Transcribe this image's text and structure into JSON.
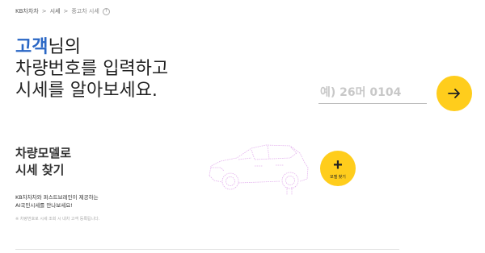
{
  "breadcrumb": {
    "home": "KB차차차",
    "section": "시세",
    "current": "중고차 시세",
    "separator": ">"
  },
  "hero": {
    "line1_accent": "고객",
    "line1_rest": "님의",
    "line2": "차량번호를 입력하고",
    "line3": "시세를 알아보세요."
  },
  "plate_search": {
    "placeholder": "예) 26머 0104",
    "value": ""
  },
  "model_search": {
    "line1": "차량모델로",
    "line2": "시세 찾기",
    "button_plus": "+",
    "button_label": "모델 찾기"
  },
  "promo": {
    "line1": "KB차차차와 퍼스트브레인이 제공하는",
    "line2": "AI국민시세를 만나보세요!"
  },
  "note": "※ 차량번호로 시세 조회 시 내차 고객 등록됩니다.",
  "colors": {
    "accent_blue": "#2a67c5",
    "button_yellow": "#ffcd1c",
    "car_outline": "#e4b3ee"
  },
  "icons": {
    "go_button": "arrow-right-icon",
    "info": "info-icon",
    "car": "suv-outline-icon"
  }
}
